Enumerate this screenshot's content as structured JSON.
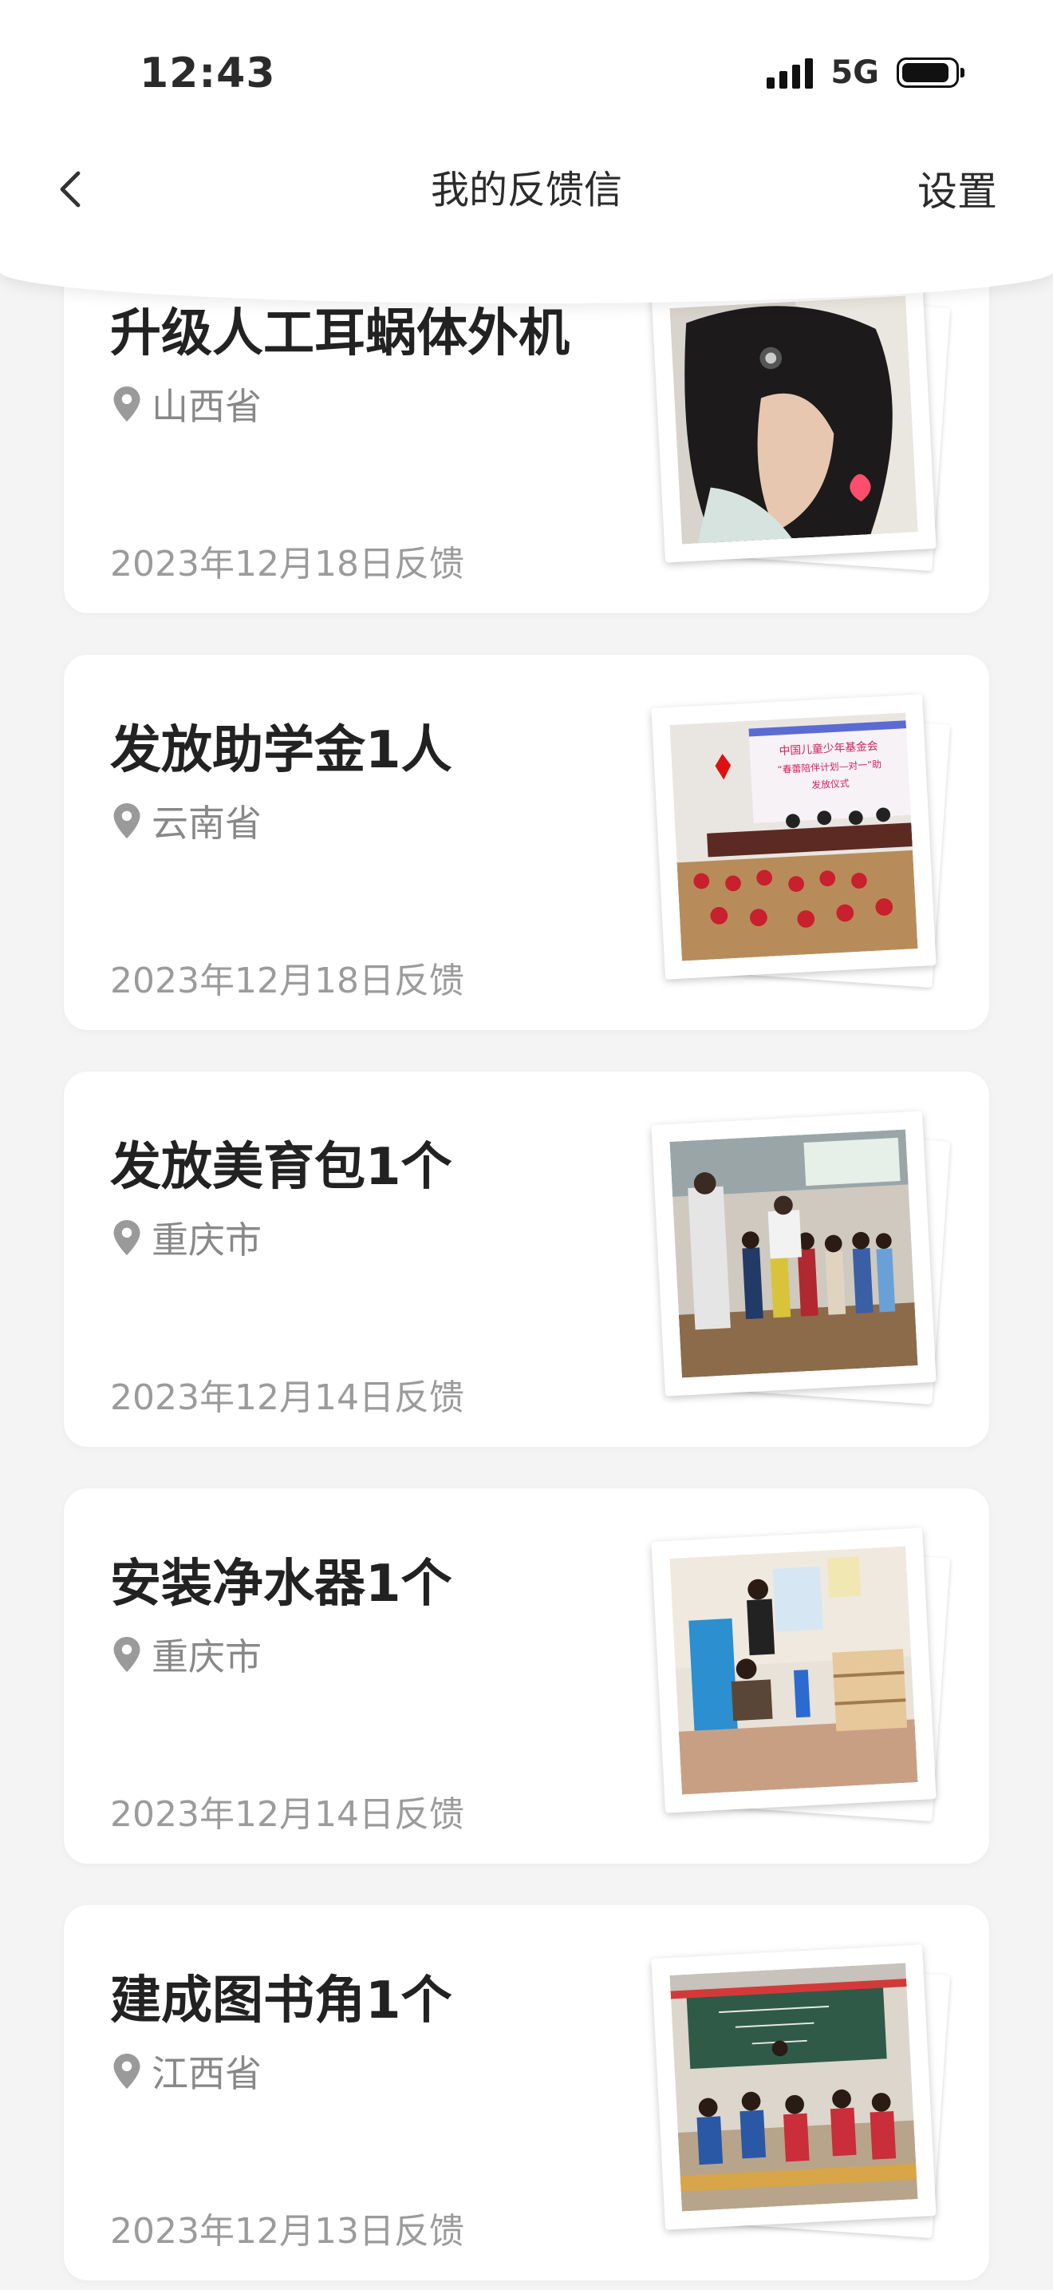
{
  "status_bar": {
    "time": "12:43",
    "network": "5G"
  },
  "header": {
    "back_icon": "chevron-left-icon",
    "title": "我的反馈信",
    "settings_label": "设置"
  },
  "cards": [
    {
      "title": "升级人工耳蜗体外机",
      "location": "山西省",
      "date": "2023年12月18日反馈",
      "photo": "child-cochlear-implant-photo"
    },
    {
      "title": "发放助学金1人",
      "location": "云南省",
      "date": "2023年12月18日反馈",
      "photo": "scholarship-ceremony-photo",
      "photo_text": [
        "中国儿童少年基金会",
        "“春蕾陪伴计划—对一”助",
        "发放仪式"
      ]
    },
    {
      "title": "发放美育包1个",
      "location": "重庆市",
      "date": "2023年12月14日反馈",
      "photo": "art-kit-distribution-photo"
    },
    {
      "title": "安装净水器1个",
      "location": "重庆市",
      "date": "2023年12月14日反馈",
      "photo": "water-purifier-install-photo"
    },
    {
      "title": "建成图书角1个",
      "location": "江西省",
      "date": "2023年12月13日反馈",
      "photo": "book-corner-classroom-photo"
    }
  ]
}
